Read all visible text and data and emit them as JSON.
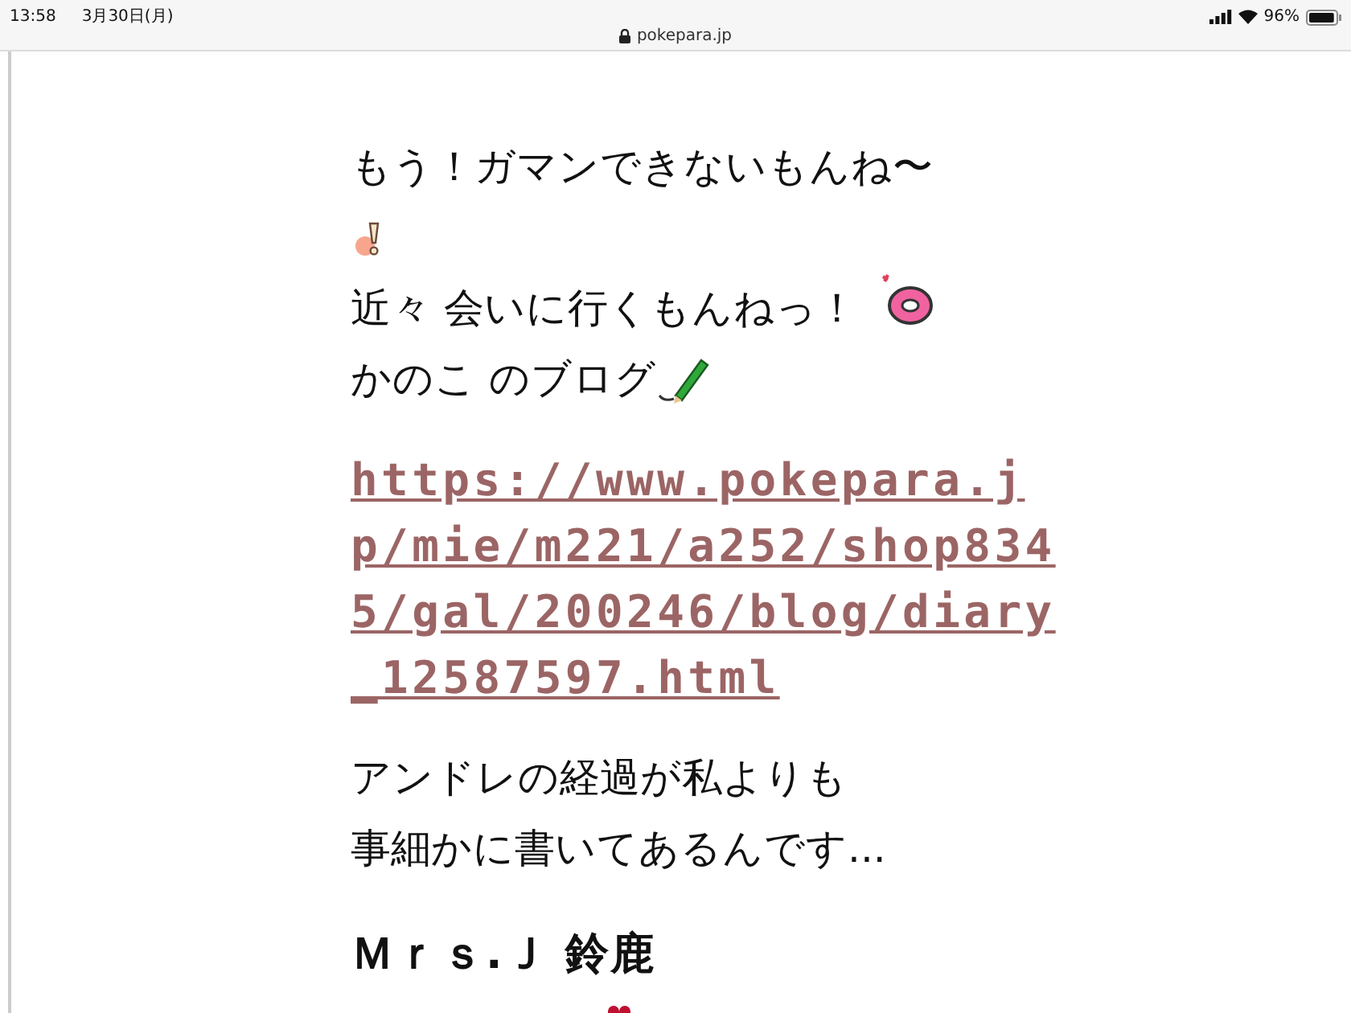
{
  "status_bar": {
    "time": "13:58",
    "date": "3月30日(月)",
    "url": "pokepara.jp",
    "battery": "96%"
  },
  "intro": {
    "lines": [
      "もう！ガマンできないもんね〜",
      "近々 会いに行くもんねっ！",
      "かのこ のブログ"
    ]
  },
  "link": {
    "text": "https://www.pokepara.jp/mie/m221/a252/shop8345/gal/200246/blog/diary_12587597.html"
  },
  "paragraph": {
    "lines": [
      "アンドレの経過が私よりも",
      "事細かに書いてあるんです..."
    ]
  },
  "heading": {
    "text": "Ｍｒｓ.Ｊ 鈴鹿"
  }
}
